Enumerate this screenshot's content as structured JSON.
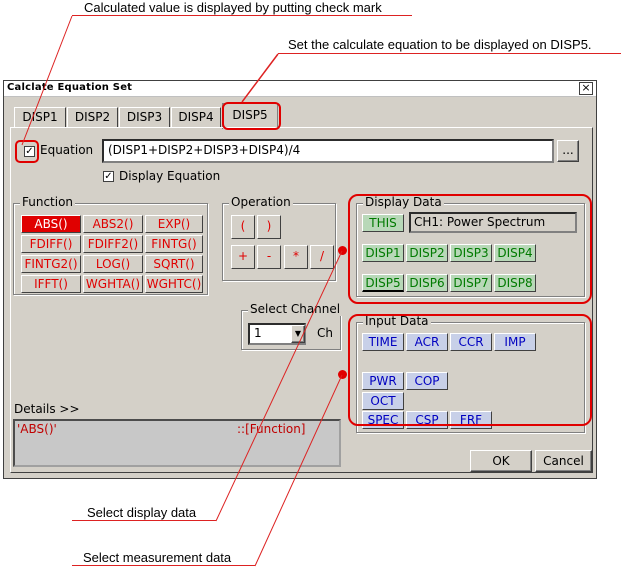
{
  "annotations": {
    "checkmark_note": "Calculated value is displayed by putting check mark",
    "disp5_note": "Set the calculate equation to be displayed on DISP5.",
    "display_data_note": "Select display data",
    "measurement_note": "Select measurement data"
  },
  "window": {
    "title": "Calclate Equation Set",
    "close_glyph": "×"
  },
  "tabs": [
    {
      "label": "DISP1"
    },
    {
      "label": "DISP2"
    },
    {
      "label": "DISP3"
    },
    {
      "label": "DISP4"
    },
    {
      "label": "DISP5",
      "active": true
    }
  ],
  "equation": {
    "checkbox_label": "Equation",
    "checked": true,
    "value": "(DISP1+DISP2+DISP3+DISP4)/4",
    "browse_label": "...",
    "display_checkbox_label": "Display Equation",
    "display_checked": true
  },
  "check_glyph": "✓",
  "function_group": {
    "title": "Function",
    "items": [
      "ABS()",
      "ABS2()",
      "EXP()",
      "FDIFF()",
      "FDIFF2()",
      "FINTG()",
      "FINTG2()",
      "LOG()",
      "SQRT()",
      "IFFT()",
      "WGHTA()",
      "WGHTC()"
    ],
    "selected": "ABS()"
  },
  "operation_group": {
    "title": "Operation",
    "items": [
      "(",
      ")",
      "+",
      "-",
      "*",
      "/"
    ]
  },
  "select_channel": {
    "title": "Select Channel",
    "value": "1",
    "unit": "Ch",
    "dropdown_glyph": "▼"
  },
  "display_data": {
    "title": "Display Data",
    "this_label": "THIS",
    "this_value": "CH1: Power Spectrum",
    "items": [
      "DISP1",
      "DISP2",
      "DISP3",
      "DISP4",
      "DISP5",
      "DISP6",
      "DISP7",
      "DISP8"
    ]
  },
  "input_data": {
    "title": "Input Data",
    "row1": [
      "TIME",
      "ACR",
      "CCR",
      "IMP"
    ],
    "row2": [
      "PWR",
      "COP"
    ],
    "row3": [
      "OCT"
    ],
    "row4": [
      "SPEC",
      "CSP",
      "FRF"
    ]
  },
  "details": {
    "label": "Details >>",
    "function_text": "'ABS()'",
    "category_text": "::[Function]"
  },
  "buttons": {
    "ok": "OK",
    "cancel": "Cancel"
  },
  "colors": {
    "highlight": "#e00000",
    "function_text": "#e00000",
    "display_data_text": "#007a00",
    "input_data_text": "#0000c0"
  }
}
